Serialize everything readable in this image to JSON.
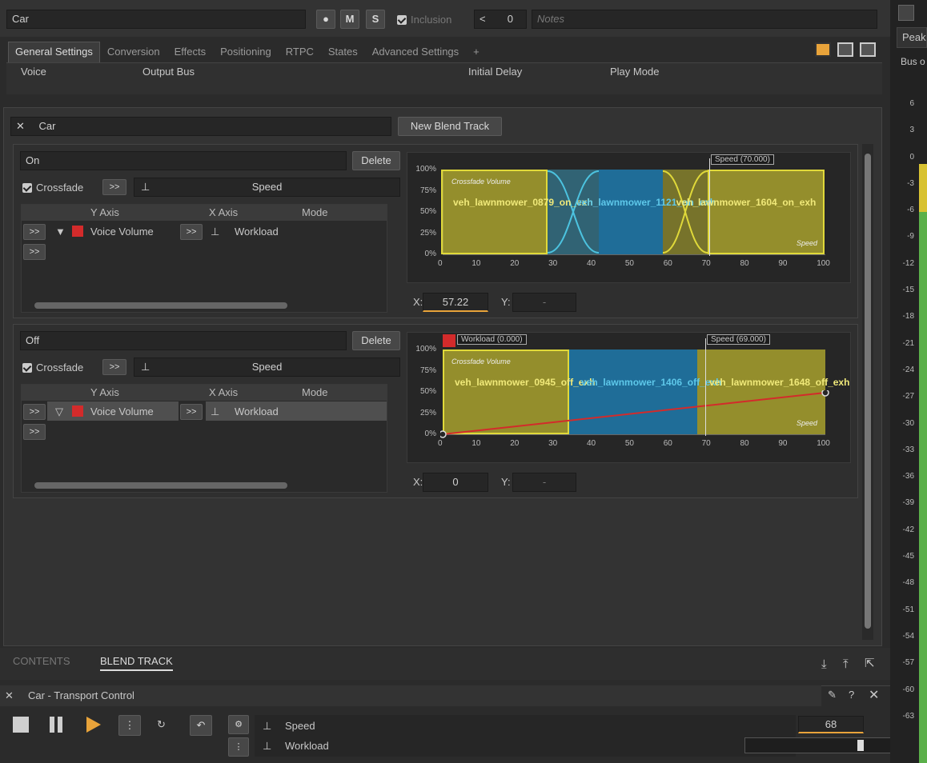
{
  "header": {
    "object_name": "Car",
    "m_label": "M",
    "s_label": "S",
    "inclusion_label": "Inclusion",
    "share_count": "0",
    "notes_placeholder": "Notes"
  },
  "tabs": [
    "General Settings",
    "Conversion",
    "Effects",
    "Positioning",
    "RTPC",
    "States",
    "Advanced Settings",
    "+"
  ],
  "general": {
    "voice": "Voice",
    "output_bus": "Output Bus",
    "initial_delay": "Initial Delay",
    "play_mode": "Play Mode"
  },
  "blend": {
    "name": "Car",
    "new_button": "New Blend Track",
    "delete": "Delete",
    "crossfade": "Crossfade",
    "arrow": ">>",
    "param": "Speed",
    "cols": {
      "y": "Y Axis",
      "x": "X Axis",
      "mode": "Mode"
    },
    "y_value": "Voice Volume",
    "x_value": "Workload",
    "x_label": "X:",
    "y_label": "Y:",
    "y_dash": "-"
  },
  "tracks": [
    {
      "name": "On",
      "x_value": "57.22",
      "cursor_label": "Speed (70.000)",
      "crossfade_title": "Crossfade Volume",
      "corner": "Speed",
      "blocks": [
        "veh_lawnmower_0879_on_exh",
        "veh_lawnmower_1121_on_exh",
        "veh_lawnmower_1604_on_exh"
      ]
    },
    {
      "name": "Off",
      "x_value": "0",
      "cursor_label": "Speed (69.000)",
      "workload_label": "Workload (0.000)",
      "crossfade_title": "Crossfade Volume",
      "corner": "Speed",
      "blocks": [
        "veh_lawnmower_0945_off_exh",
        "veh_lawnmower_1406_off_exh",
        "veh_lawnmower_1648_off_exh"
      ]
    }
  ],
  "y_ticks": [
    "100%",
    "75%",
    "50%",
    "25%",
    "0%"
  ],
  "x_ticks": [
    "0",
    "10",
    "20",
    "30",
    "40",
    "50",
    "60",
    "70",
    "80",
    "90",
    "100"
  ],
  "bottom_tabs": {
    "contents": "CONTENTS",
    "blend": "BLEND TRACK"
  },
  "transport": {
    "title": "Car - Transport Control",
    "speed": "Speed",
    "workload": "Workload",
    "value": "68"
  },
  "meter": {
    "peak": "Peak",
    "bus": "Bus o",
    "ticks": [
      "6",
      "3",
      "0",
      "-3",
      "-6",
      "-9",
      "-12",
      "-15",
      "-18",
      "-21",
      "-24",
      "-27",
      "-30",
      "-33",
      "-36",
      "-39",
      "-42",
      "-45",
      "-48",
      "-51",
      "-54",
      "-57",
      "-60",
      "-63"
    ]
  },
  "colors": {
    "yellow": "#b9b22f",
    "blue": "#1f6d98",
    "accent": "#e8a33a",
    "red": "#d32b2b",
    "green": "#5bb04a"
  }
}
